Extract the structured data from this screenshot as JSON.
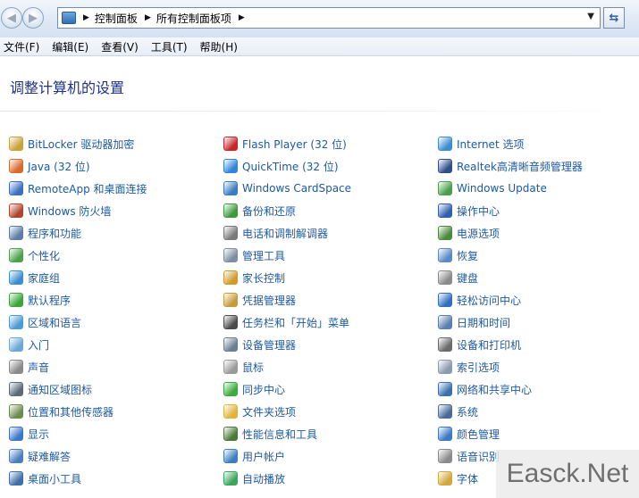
{
  "address_bar": {
    "crumbs": [
      "控制面板",
      "所有控制面板项"
    ]
  },
  "menu": [
    "文件(F)",
    "编辑(E)",
    "查看(V)",
    "工具(T)",
    "帮助(H)"
  ],
  "page_title": "调整计算机的设置",
  "columns": [
    [
      {
        "label": "BitLocker 驱动器加密",
        "icon": "bitlocker-icon",
        "color": "#c9a23a"
      },
      {
        "label": "Java (32 位)",
        "icon": "java-icon",
        "color": "#d86a2a"
      },
      {
        "label": "RemoteApp 和桌面连接",
        "icon": "remoteapp-icon",
        "color": "#3a6fc1"
      },
      {
        "label": "Windows 防火墙",
        "icon": "firewall-icon",
        "color": "#b3442c"
      },
      {
        "label": "程序和功能",
        "icon": "programs-icon",
        "color": "#5c7ea6"
      },
      {
        "label": "个性化",
        "icon": "personalization-icon",
        "color": "#4aa24a"
      },
      {
        "label": "家庭组",
        "icon": "homegroup-icon",
        "color": "#3b8fd1"
      },
      {
        "label": "默认程序",
        "icon": "default-programs-icon",
        "color": "#3aa63a"
      },
      {
        "label": "区域和语言",
        "icon": "region-language-icon",
        "color": "#4a9bd6"
      },
      {
        "label": "入门",
        "icon": "getting-started-icon",
        "color": "#6aa8d8"
      },
      {
        "label": "声音",
        "icon": "sound-icon",
        "color": "#8a8a8a"
      },
      {
        "label": "通知区域图标",
        "icon": "notification-icons-icon",
        "color": "#5a6a7a"
      },
      {
        "label": "位置和其他传感器",
        "icon": "location-sensors-icon",
        "color": "#6b8e4e"
      },
      {
        "label": "显示",
        "icon": "display-icon",
        "color": "#3c78c8"
      },
      {
        "label": "疑难解答",
        "icon": "troubleshooting-icon",
        "color": "#4a7fc0"
      },
      {
        "label": "桌面小工具",
        "icon": "gadgets-icon",
        "color": "#3d6fa8"
      }
    ],
    [
      {
        "label": "Flash Player (32 位)",
        "icon": "flash-player-icon",
        "color": "#c8262a"
      },
      {
        "label": "QuickTime (32 位)",
        "icon": "quicktime-icon",
        "color": "#2f86d6"
      },
      {
        "label": "Windows CardSpace",
        "icon": "cardspace-icon",
        "color": "#3a7cc4"
      },
      {
        "label": "备份和还原",
        "icon": "backup-restore-icon",
        "color": "#3d9a3d"
      },
      {
        "label": "电话和调制解调器",
        "icon": "phone-modem-icon",
        "color": "#7a7a7a"
      },
      {
        "label": "管理工具",
        "icon": "admin-tools-icon",
        "color": "#7d8ea3"
      },
      {
        "label": "家长控制",
        "icon": "parental-controls-icon",
        "color": "#d29a2a"
      },
      {
        "label": "凭据管理器",
        "icon": "credential-manager-icon",
        "color": "#c89b3a"
      },
      {
        "label": "任务栏和「开始」菜单",
        "icon": "taskbar-start-icon",
        "color": "#4a4a4a"
      },
      {
        "label": "设备管理器",
        "icon": "device-manager-icon",
        "color": "#6a7f95"
      },
      {
        "label": "鼠标",
        "icon": "mouse-icon",
        "color": "#9a9a9a"
      },
      {
        "label": "同步中心",
        "icon": "sync-center-icon",
        "color": "#3caa3c"
      },
      {
        "label": "文件夹选项",
        "icon": "folder-options-icon",
        "color": "#e0b43a"
      },
      {
        "label": "性能信息和工具",
        "icon": "performance-icon",
        "color": "#4a7a3a"
      },
      {
        "label": "用户帐户",
        "icon": "user-accounts-icon",
        "color": "#3d7fc0"
      },
      {
        "label": "自动播放",
        "icon": "autoplay-icon",
        "color": "#3aa65a"
      }
    ],
    [
      {
        "label": "Internet 选项",
        "icon": "internet-options-icon",
        "color": "#3a8fd0"
      },
      {
        "label": "Realtek高清晰音频管理器",
        "icon": "realtek-audio-icon",
        "color": "#2f4f8a"
      },
      {
        "label": "Windows Update",
        "icon": "windows-update-icon",
        "color": "#4aa04a"
      },
      {
        "label": "操作中心",
        "icon": "action-center-icon",
        "color": "#2f5fb0"
      },
      {
        "label": "电源选项",
        "icon": "power-options-icon",
        "color": "#4a8a3a"
      },
      {
        "label": "恢复",
        "icon": "recovery-icon",
        "color": "#5a8ac8"
      },
      {
        "label": "键盘",
        "icon": "keyboard-icon",
        "color": "#8a8a8a"
      },
      {
        "label": "轻松访问中心",
        "icon": "ease-of-access-icon",
        "color": "#2f6fc0"
      },
      {
        "label": "日期和时间",
        "icon": "date-time-icon",
        "color": "#5a7fb0"
      },
      {
        "label": "设备和打印机",
        "icon": "devices-printers-icon",
        "color": "#6a6a6a"
      },
      {
        "label": "索引选项",
        "icon": "indexing-options-icon",
        "color": "#8a9ab0"
      },
      {
        "label": "网络和共享中心",
        "icon": "network-sharing-icon",
        "color": "#3a6fb0"
      },
      {
        "label": "系统",
        "icon": "system-icon",
        "color": "#4a6a9a"
      },
      {
        "label": "颜色管理",
        "icon": "color-management-icon",
        "color": "#3a7ac8"
      },
      {
        "label": "语音识别",
        "icon": "speech-recognition-icon",
        "color": "#8a8a8a"
      },
      {
        "label": "字体",
        "icon": "fonts-icon",
        "color": "#d2a83a"
      }
    ]
  ],
  "watermark": "Easck.Net"
}
